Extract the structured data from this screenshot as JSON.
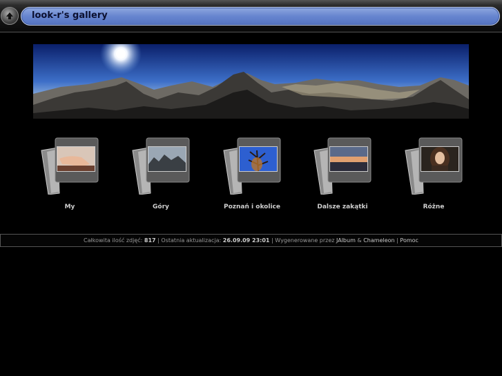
{
  "header": {
    "title": "look-r's gallery",
    "up_icon": "up-arrow-icon"
  },
  "banner": {
    "image": "mountain-panorama"
  },
  "albums": [
    {
      "label": "My",
      "thumb": "hands"
    },
    {
      "label": "Góry",
      "thumb": "mountains"
    },
    {
      "label": "Poznań i okolice",
      "thumb": "tree-sky"
    },
    {
      "label": "Dalsze zakątki",
      "thumb": "sunset-sea"
    },
    {
      "label": "Różne",
      "thumb": "portrait"
    }
  ],
  "footer": {
    "count_label": "Całkowita ilość zdjęć:",
    "count_value": "817",
    "sep1": "|",
    "updated_label": "Ostatnia aktualizacja:",
    "updated_value": "26.09.09 23:01",
    "sep2": "|",
    "generated_label": "Wygenerowane przez",
    "jalbum": "JAlbum",
    "amp": "&",
    "chameleon": "Chameleon",
    "sep3": "|",
    "help": "Pomoc"
  },
  "colors": {
    "background": "#000000",
    "title_pill": "#6785cf",
    "title_text": "#0b1030"
  }
}
